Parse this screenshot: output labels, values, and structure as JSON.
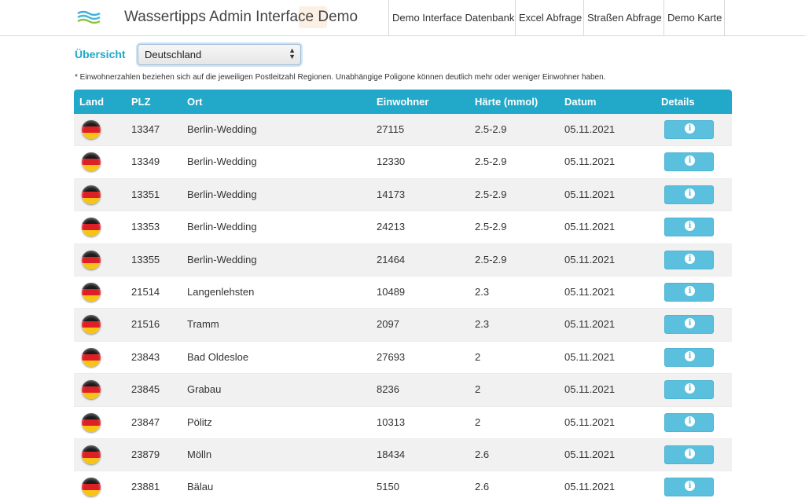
{
  "header": {
    "brand": "Wassertipps Admin Interface Demo",
    "nav": [
      "Demo Interface Datenbank",
      "Excel Abfrage",
      "Straßen Abfrage",
      "Demo Karte"
    ]
  },
  "filter": {
    "label": "Übersicht",
    "selected": "Deutschland"
  },
  "note": "* Einwohnerzahlen beziehen sich auf die jeweiligen Postleitzahl Regionen. Unabhängige Poligone können deutlich mehr oder weniger Einwohner haben.",
  "table": {
    "columns": [
      "Land",
      "PLZ",
      "Ort",
      "Einwohner",
      "Härte (mmol)",
      "Datum",
      "Details"
    ],
    "rows": [
      {
        "plz": "13347",
        "ort": "Berlin-Wedding",
        "einwohner": "27115",
        "haerte": "2.5-2.9",
        "datum": "05.11.2021"
      },
      {
        "plz": "13349",
        "ort": "Berlin-Wedding",
        "einwohner": "12330",
        "haerte": "2.5-2.9",
        "datum": "05.11.2021"
      },
      {
        "plz": "13351",
        "ort": "Berlin-Wedding",
        "einwohner": "14173",
        "haerte": "2.5-2.9",
        "datum": "05.11.2021"
      },
      {
        "plz": "13353",
        "ort": "Berlin-Wedding",
        "einwohner": "24213",
        "haerte": "2.5-2.9",
        "datum": "05.11.2021"
      },
      {
        "plz": "13355",
        "ort": "Berlin-Wedding",
        "einwohner": "21464",
        "haerte": "2.5-2.9",
        "datum": "05.11.2021"
      },
      {
        "plz": "21514",
        "ort": "Langenlehsten",
        "einwohner": "10489",
        "haerte": "2.3",
        "datum": "05.11.2021"
      },
      {
        "plz": "21516",
        "ort": "Tramm",
        "einwohner": "2097",
        "haerte": "2.3",
        "datum": "05.11.2021"
      },
      {
        "plz": "23843",
        "ort": "Bad Oldesloe",
        "einwohner": "27693",
        "haerte": "2",
        "datum": "05.11.2021"
      },
      {
        "plz": "23845",
        "ort": "Grabau",
        "einwohner": "8236",
        "haerte": "2",
        "datum": "05.11.2021"
      },
      {
        "plz": "23847",
        "ort": "Pölitz",
        "einwohner": "10313",
        "haerte": "2",
        "datum": "05.11.2021"
      },
      {
        "plz": "23879",
        "ort": "Mölln",
        "einwohner": "18434",
        "haerte": "2.6",
        "datum": "05.11.2021"
      },
      {
        "plz": "23881",
        "ort": "Bälau",
        "einwohner": "5150",
        "haerte": "2.6",
        "datum": "05.11.2021"
      }
    ],
    "row_icons": {
      "flag": "germany-flag-icon",
      "details": "info-icon"
    }
  },
  "colors": {
    "accent": "#22a9c9",
    "info_button": "#5bc0de"
  }
}
